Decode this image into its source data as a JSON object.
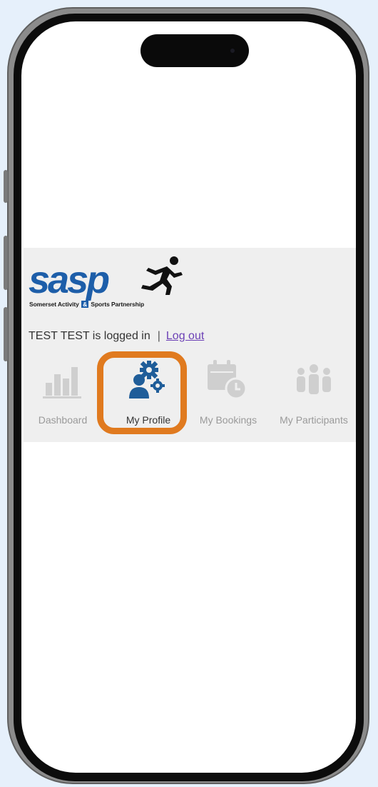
{
  "app": {
    "logo_text": "sasp",
    "logo_tagline_left": "Somerset Activity",
    "logo_tagline_amp": "&",
    "logo_tagline_right": "Sports Partnership"
  },
  "session": {
    "logged_in_text": "TEST TEST is logged in",
    "separator": "|",
    "logout_label": "Log out"
  },
  "nav": {
    "items": [
      {
        "label": "Dashboard",
        "icon": "bar-chart-icon",
        "active": false
      },
      {
        "label": "My Profile",
        "icon": "user-gear-icon",
        "active": true
      },
      {
        "label": "My Bookings",
        "icon": "calendar-clock-icon",
        "active": false
      },
      {
        "label": "My Participants",
        "icon": "group-icon",
        "active": false
      }
    ]
  },
  "colors": {
    "brand_blue": "#1d5ea9",
    "active_icon": "#1f5d99",
    "inactive_icon": "#cfcfcf",
    "highlight": "#e07a1f",
    "link": "#6b3fb5",
    "page_background": "#e6f0fb"
  }
}
